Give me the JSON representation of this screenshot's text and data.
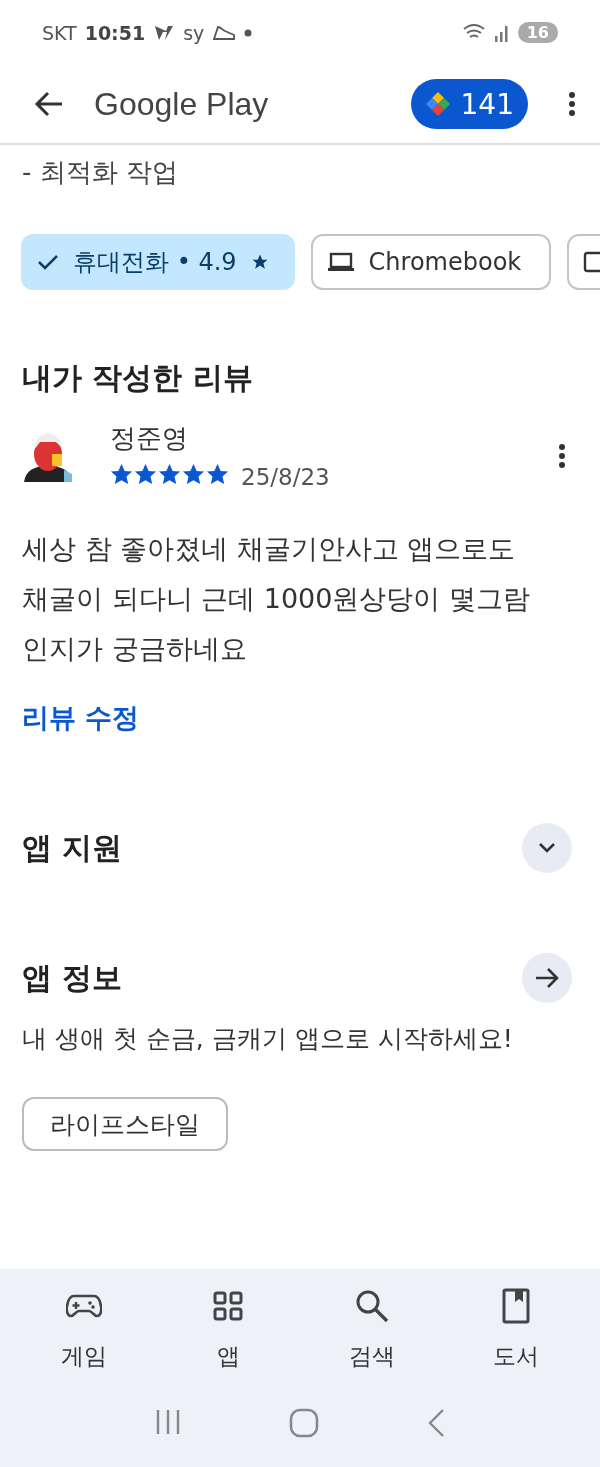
{
  "status_bar": {
    "carrier": "SKT",
    "time": "10:51",
    "indicator": "sy",
    "battery": "16"
  },
  "header": {
    "title": "Google Play",
    "points": "141"
  },
  "intro_text": "- 최적화 작업",
  "device_chips": [
    {
      "kind": "phone",
      "label": "휴대전화 • 4.9",
      "selected": true
    },
    {
      "kind": "laptop",
      "label": "Chromebook",
      "selected": false
    },
    {
      "kind": "tablet",
      "selected": false
    }
  ],
  "my_review": {
    "heading": "내가 작성한 리뷰",
    "author": "정준영",
    "stars": 5,
    "date": "25/8/23",
    "text": "세상 참 좋아졌네 채굴기안사고 앱으로도 채굴이 되다니 근데 1000원상당이 몇그람인지가 궁금하네요",
    "edit_link": "리뷰 수정"
  },
  "sections": [
    {
      "kind": "expand",
      "title": "앱 지원"
    },
    {
      "kind": "arrow",
      "title": "앱 정보",
      "description": "내 생애 첫 순금, 금캐기 앱으로 시작하세요!",
      "tags": [
        "라이프스타일"
      ]
    }
  ],
  "bottom_nav": [
    {
      "kind": "games",
      "label": "게임"
    },
    {
      "kind": "apps",
      "label": "앱"
    },
    {
      "kind": "search",
      "label": "검색"
    },
    {
      "kind": "books",
      "label": "도서"
    }
  ]
}
